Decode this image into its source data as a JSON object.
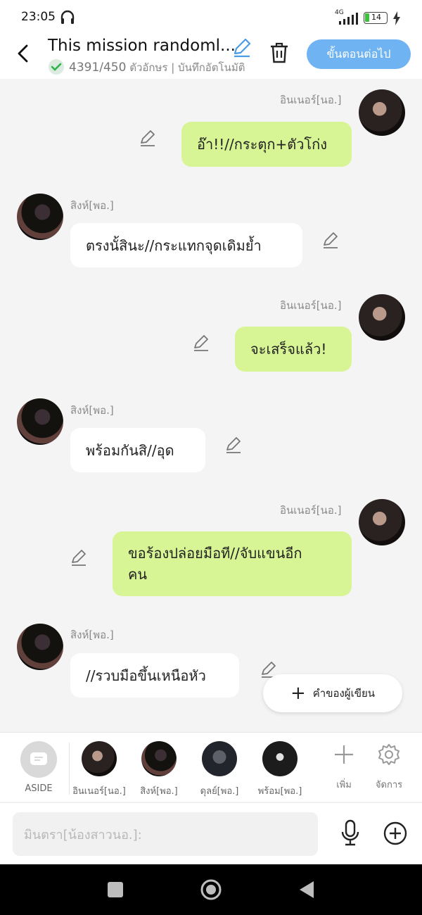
{
  "status_bar": {
    "time": "23:05",
    "network": "4G",
    "battery": "14"
  },
  "header": {
    "title": "This mission randoml...",
    "char_count": "4391/450",
    "char_unit": "ตัวอักษร",
    "autosave": "บันทึกอัตโนมัติ",
    "next_button": "ขั้นตอนต่อไป"
  },
  "messages": [
    {
      "side": "right",
      "name": "อินเนอร์[นอ.]",
      "text": "อ๊า!!//กระตุก+ตัวโก่ง"
    },
    {
      "side": "left",
      "name": "สิงห์[พอ.]",
      "text": "ตรงนั้สินะ//กระแทกจุดเดิมย้ำ"
    },
    {
      "side": "right",
      "name": "อินเนอร์[นอ.]",
      "text": "จะเสร็จแล้ว!"
    },
    {
      "side": "left",
      "name": "สิงห์[พอ.]",
      "text": "พร้อมกันสิ//อุด"
    },
    {
      "side": "right",
      "name": "อินเนอร์[นอ.]",
      "text_line1": "ขอร้องปล่อยมือที//จับแขนอีก",
      "text_line2": "คน"
    },
    {
      "side": "left",
      "name": "สิงห์[พอ.]",
      "text": "//รวบมือขึ้นเหนือหัว"
    }
  ],
  "float_button": {
    "label": "คำของผู้เขียน"
  },
  "character_bar": {
    "aside": "ASIDE",
    "characters": [
      "อินเนอร์[นอ.]",
      "สิงห์[พอ.]",
      "ดุลย์[พอ.]",
      "พร้อม[พอ.]"
    ],
    "add": "เพิ่ม",
    "manage": "จัดการ"
  },
  "input": {
    "placeholder": "มินตรา[น้องสาวนอ.]:"
  }
}
